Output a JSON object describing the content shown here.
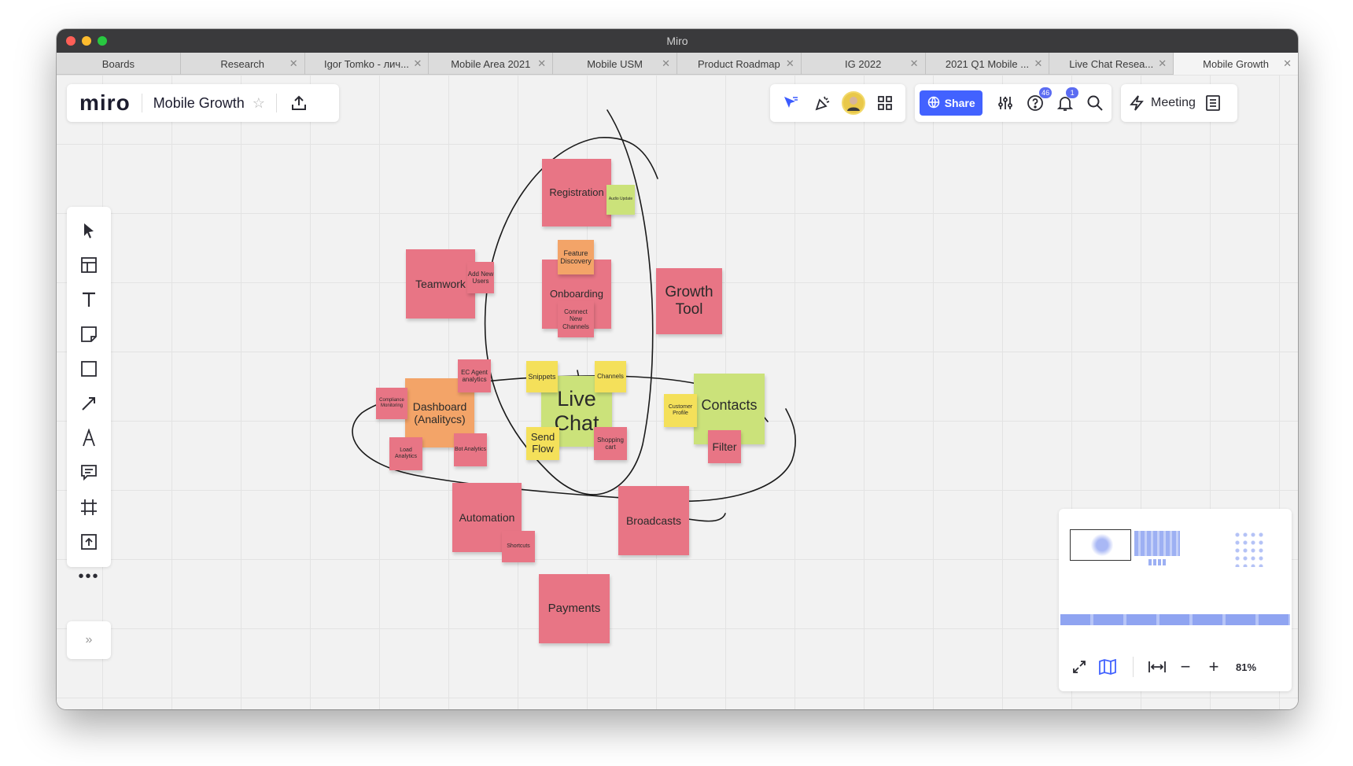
{
  "window": {
    "title": "Miro"
  },
  "tabs": [
    {
      "label": "Boards",
      "closable": false
    },
    {
      "label": "Research",
      "closable": true
    },
    {
      "label": "Igor Tomko - лич...",
      "closable": true
    },
    {
      "label": "Mobile Area 2021",
      "closable": true
    },
    {
      "label": "Mobile USM",
      "closable": true
    },
    {
      "label": "Product Roadmap",
      "closable": true
    },
    {
      "label": "IG 2022",
      "closable": true
    },
    {
      "label": "2021 Q1 Mobile ...",
      "closable": true
    },
    {
      "label": "Live Chat Resea...",
      "closable": true
    },
    {
      "label": "Mobile Growth",
      "closable": true,
      "active": true
    }
  ],
  "header": {
    "logo": "miro",
    "board_title": "Mobile Growth",
    "share_label": "Share",
    "help_badge": "46",
    "notifications_badge": "1",
    "meeting_label": "Meeting"
  },
  "stickies": {
    "registration": "Registration",
    "audio_update": "Audio Update",
    "feature_discovery": "Feature Discovery",
    "onboarding": "Onboarding",
    "connect_new_channels": "Connect New Channels",
    "teamwork": "Teamwork",
    "add_new_users": "Add New Users",
    "growth_tool": "Growth Tool",
    "ec_agent_analytics": "EC Agent analytics",
    "compliance_monitoring": "Compliance Monitoring",
    "dashboard": "Dashboard (Analitycs)",
    "load_analytics": "Load Analytics",
    "bot_analytics": "Bot Analytics",
    "snippets": "Snippets",
    "channels": "Channels",
    "live_chat": "Live Chat",
    "send_flow": "Send Flow",
    "shopping_cart": "Shopping cart",
    "customer_profile": "Customer Profile",
    "contacts": "Contacts",
    "filter": "Filter",
    "automation": "Automation",
    "shortcuts": "Shortcuts",
    "broadcasts": "Broadcasts",
    "payments": "Payments"
  },
  "minimap": {
    "zoom": "81%"
  },
  "colors": {
    "accent": "#4262ff",
    "pink_sticky": "#e87585",
    "orange_sticky": "#f3a468",
    "yellow_sticky": "#f4e05a",
    "lime_sticky": "#cbe27a"
  }
}
